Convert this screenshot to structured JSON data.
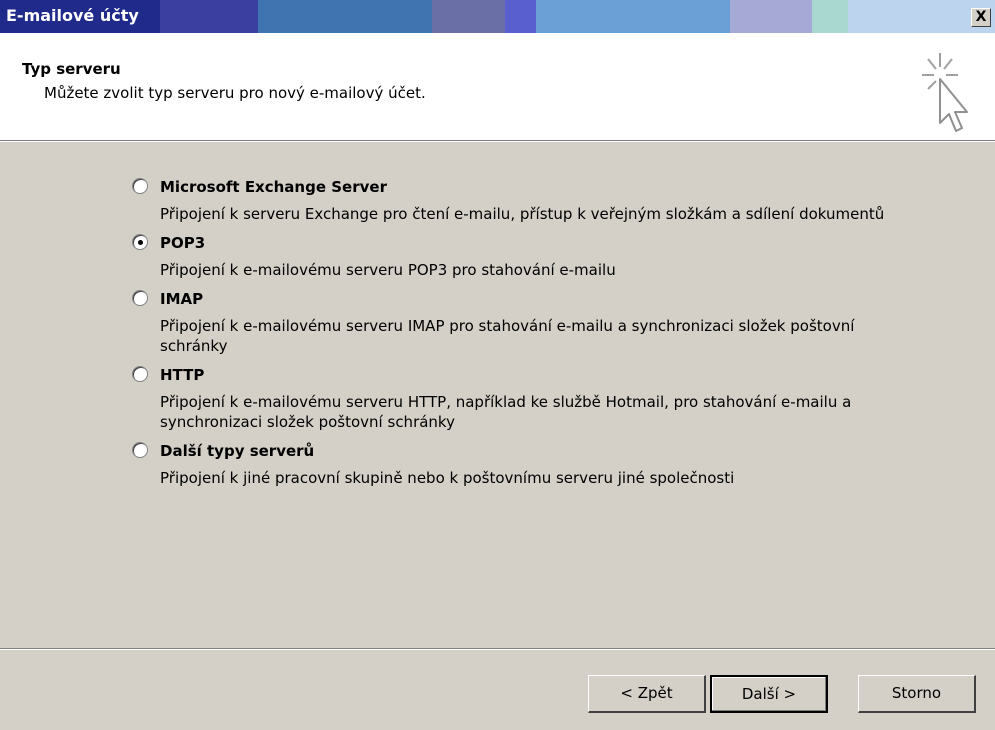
{
  "window": {
    "title": "E-mailové účty",
    "close_label": "X"
  },
  "header": {
    "title": "Typ serveru",
    "subtitle": "Můžete zvolit typ serveru pro nový e-mailový účet.",
    "icon": "wizard-cursor-icon"
  },
  "options": [
    {
      "label": "Microsoft Exchange Server",
      "description": "Připojení k serveru Exchange pro čtení e-mailu, přístup k veřejným složkám a sdílení dokumentů",
      "selected": false
    },
    {
      "label": "POP3",
      "description": "Připojení k e-mailovému serveru POP3 pro stahování e-mailu",
      "selected": true
    },
    {
      "label": "IMAP",
      "description": "Připojení k e-mailovému serveru IMAP pro stahování e-mailu a synchronizaci složek poštovní schránky",
      "selected": false
    },
    {
      "label": "HTTP",
      "description": "Připojení k e-mailovému serveru HTTP, například ke službě Hotmail, pro stahování e-mailu a synchronizaci složek poštovní schránky",
      "selected": false
    },
    {
      "label": "Další typy serverů",
      "description": "Připojení k jiné pracovní skupině nebo k poštovnímu serveru jiné společnosti",
      "selected": false
    }
  ],
  "buttons": {
    "back": "< Zpět",
    "next": "Další >",
    "cancel": "Storno"
  }
}
